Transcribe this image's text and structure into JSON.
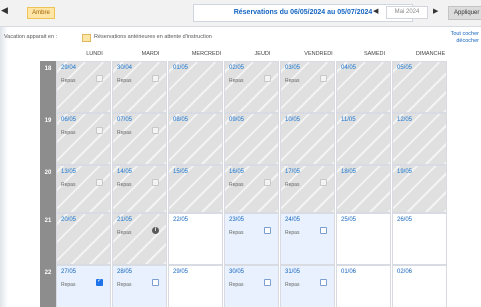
{
  "toolbar": {
    "legend_chip": "Ambre",
    "period_from_label": "Réservations du",
    "period_from": "06/05/2024",
    "period_to_label": "au",
    "period_to": "05/07/2024",
    "month_value": "Mai 2024",
    "apply_label": "Appliquer"
  },
  "legend": {
    "text1": "Vacation apparait en :",
    "text2": "Réservations antérieures en attente d'instruction"
  },
  "side_links": [
    "Tout cocher",
    "décocher"
  ],
  "days": [
    "LUNDI",
    "MARDI",
    "MERCREDI",
    "JEUDI",
    "VENDREDI",
    "SAMEDI",
    "DIMANCHE"
  ],
  "weeks": [
    {
      "num": "18",
      "cells": [
        {
          "date": "29/04",
          "label": "Repas",
          "state": "past",
          "box": "past"
        },
        {
          "date": "30/04",
          "label": "Repas",
          "state": "past",
          "box": "past"
        },
        {
          "date": "01/05",
          "label": "",
          "state": "past",
          "box": ""
        },
        {
          "date": "02/05",
          "label": "Repas",
          "state": "past",
          "box": "past"
        },
        {
          "date": "03/05",
          "label": "Repas",
          "state": "past",
          "box": "past"
        },
        {
          "date": "04/05",
          "label": "",
          "state": "past",
          "box": ""
        },
        {
          "date": "05/05",
          "label": "",
          "state": "past",
          "box": ""
        }
      ]
    },
    {
      "num": "19",
      "cells": [
        {
          "date": "06/05",
          "label": "Repas",
          "state": "past",
          "box": "past"
        },
        {
          "date": "07/05",
          "label": "Repas",
          "state": "past",
          "box": "past"
        },
        {
          "date": "08/05",
          "label": "",
          "state": "past",
          "box": ""
        },
        {
          "date": "09/05",
          "label": "",
          "state": "past",
          "box": ""
        },
        {
          "date": "10/05",
          "label": "",
          "state": "past",
          "box": ""
        },
        {
          "date": "11/05",
          "label": "",
          "state": "past",
          "box": ""
        },
        {
          "date": "12/05",
          "label": "",
          "state": "past",
          "box": ""
        }
      ]
    },
    {
      "num": "20",
      "cells": [
        {
          "date": "13/05",
          "label": "Repas",
          "state": "past",
          "box": "past"
        },
        {
          "date": "14/05",
          "label": "Repas",
          "state": "past",
          "box": "past"
        },
        {
          "date": "15/05",
          "label": "",
          "state": "past",
          "box": ""
        },
        {
          "date": "16/05",
          "label": "Repas",
          "state": "past",
          "box": "past"
        },
        {
          "date": "17/05",
          "label": "Repas",
          "state": "past",
          "box": "past"
        },
        {
          "date": "18/05",
          "label": "",
          "state": "past",
          "box": ""
        },
        {
          "date": "19/05",
          "label": "",
          "state": "past",
          "box": ""
        }
      ]
    },
    {
      "num": "21",
      "cells": [
        {
          "date": "20/05",
          "label": "",
          "state": "past",
          "box": ""
        },
        {
          "date": "21/05",
          "label": "Repas",
          "state": "past",
          "box": "info"
        },
        {
          "date": "22/05",
          "label": "",
          "state": "free",
          "box": ""
        },
        {
          "date": "23/05",
          "label": "Repas",
          "state": "avail",
          "box": "empty"
        },
        {
          "date": "24/05",
          "label": "Repas",
          "state": "avail",
          "box": "empty"
        },
        {
          "date": "25/05",
          "label": "",
          "state": "free",
          "box": ""
        },
        {
          "date": "26/05",
          "label": "",
          "state": "free",
          "box": ""
        }
      ]
    },
    {
      "num": "22",
      "cells": [
        {
          "date": "27/05",
          "label": "Repas",
          "state": "avail",
          "box": "checked"
        },
        {
          "date": "28/05",
          "label": "Repas",
          "state": "avail",
          "box": "empty"
        },
        {
          "date": "29/05",
          "label": "",
          "state": "free",
          "box": ""
        },
        {
          "date": "30/05",
          "label": "Repas",
          "state": "avail",
          "box": "empty"
        },
        {
          "date": "31/05",
          "label": "Repas",
          "state": "avail",
          "box": "empty"
        },
        {
          "date": "01/06",
          "label": "",
          "state": "free",
          "box": ""
        },
        {
          "date": "02/06",
          "label": "",
          "state": "free",
          "box": ""
        }
      ]
    }
  ]
}
